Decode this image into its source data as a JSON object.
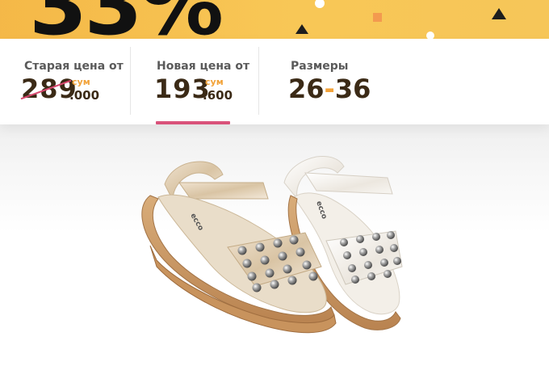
{
  "banner": {
    "big_text": "33%",
    "colors": {
      "background": "#f7c04e",
      "accent": "#f2a33a"
    }
  },
  "prices": {
    "old": {
      "label": "Старая цена от",
      "main": "289",
      "currency": "сум",
      "fraction": ".000"
    },
    "new": {
      "label": "Новая цена от",
      "main": "193",
      "currency": "сум",
      "fraction": ".600"
    },
    "sizes": {
      "label": "Размеры",
      "from": "26",
      "separator": "-",
      "to": "36"
    }
  },
  "product": {
    "brand": "ecco"
  },
  "colors": {
    "price_text": "#3b2a16",
    "label_text": "#5a5a5a",
    "currency": "#f2a33a",
    "highlight": "#d9527a"
  }
}
